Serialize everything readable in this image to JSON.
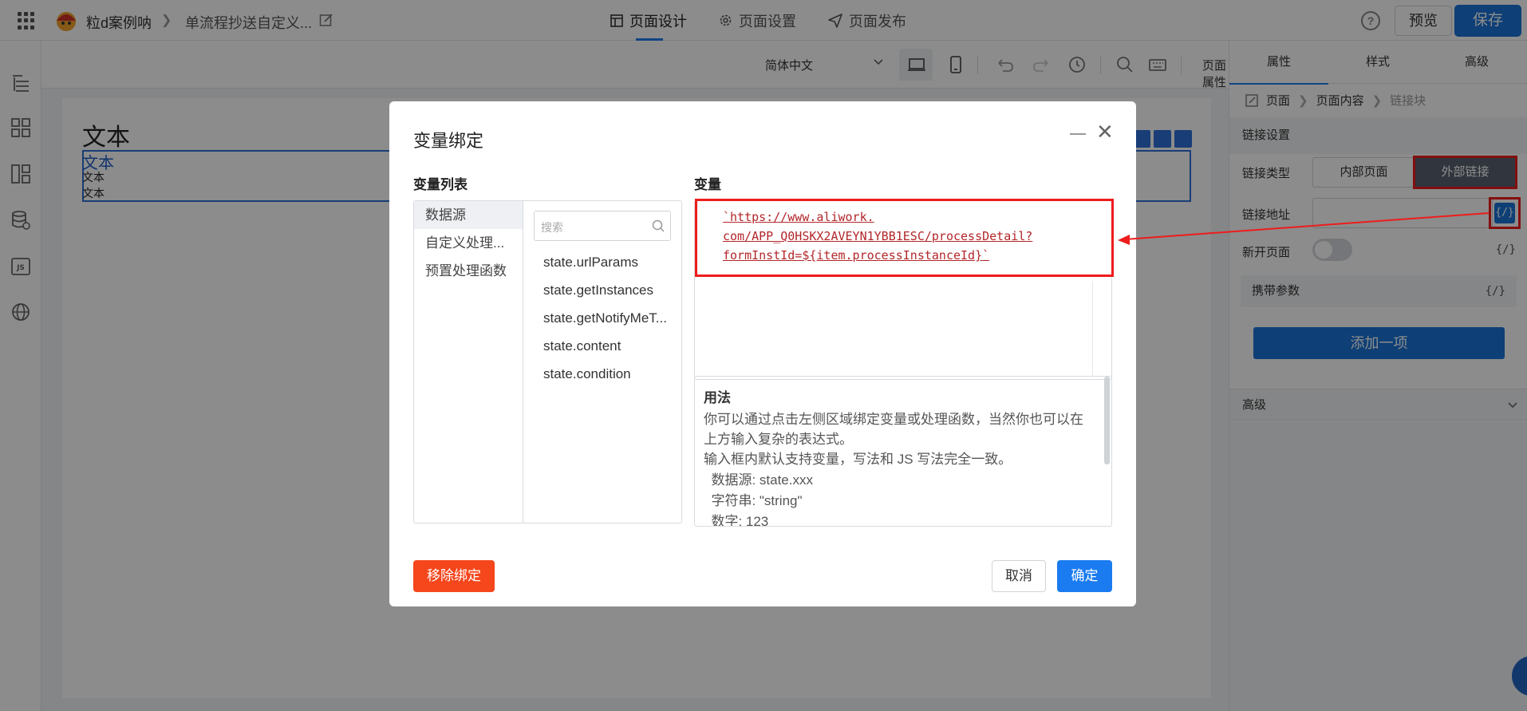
{
  "header": {
    "app_name": "粒d案例呐",
    "page_name": "单流程抄送自定义...",
    "tabs": [
      {
        "label": "页面设计",
        "icon": "layout-icon"
      },
      {
        "label": "页面设置",
        "icon": "gear-icon"
      },
      {
        "label": "页面发布",
        "icon": "send-icon"
      }
    ],
    "help": "?",
    "preview_label": "预览",
    "save_label": "保存"
  },
  "toolbar": {
    "language": "简体中文",
    "page_attr": "页面属性"
  },
  "canvas": {
    "big_text": "文本",
    "link_text": "文本",
    "text1": "文本",
    "text2": "文本"
  },
  "right_panel": {
    "tabs": [
      "属性",
      "样式",
      "高级"
    ],
    "breadcrumb": [
      "页面",
      "页面内容",
      "链接块"
    ],
    "section_title": "链接设置",
    "link_type_label": "链接类型",
    "link_type_options": [
      "内部页面",
      "外部链接"
    ],
    "link_type_selected": "外部链接",
    "link_url_label": "链接地址",
    "bind_symbol": "{/}",
    "new_page_label": "新开页面",
    "new_page_on": false,
    "carry_params_label": "携带参数",
    "add_item_label": "添加一项",
    "advanced_label": "高级"
  },
  "modal": {
    "title": "变量绑定",
    "var_list_label": "变量列表",
    "var_label": "变量",
    "categories": [
      "数据源",
      "自定义处理...",
      "预置处理函数"
    ],
    "selected_category": "数据源",
    "search_placeholder": "搜索",
    "variables": [
      "state.urlParams",
      "state.getInstances",
      "state.getNotifyMeT...",
      "state.content",
      "state.condition"
    ],
    "expression_lines": [
      "`https://www.aliwork.",
      "com/APP_Q0HSKX2AVEYN1YBB1ESC/processDetail?",
      "formInstId=${item.processInstanceId}`"
    ],
    "usage": {
      "title": "用法",
      "lines": [
        "你可以通过点击左侧区域绑定变量或处理函数，当然你也可以在",
        "上方输入复杂的表达式。",
        "输入框内默认支持变量，写法和 JS 写法完全一致。",
        "  数据源: state.xxx",
        "  字符串: \"string\"",
        "  数字: 123"
      ]
    },
    "unbind_label": "移除绑定",
    "cancel_label": "取消",
    "ok_label": "确定"
  },
  "colors": {
    "primary": "#1b74d8",
    "danger": "#f5461c",
    "annotation_red": "#ee1c1c"
  }
}
